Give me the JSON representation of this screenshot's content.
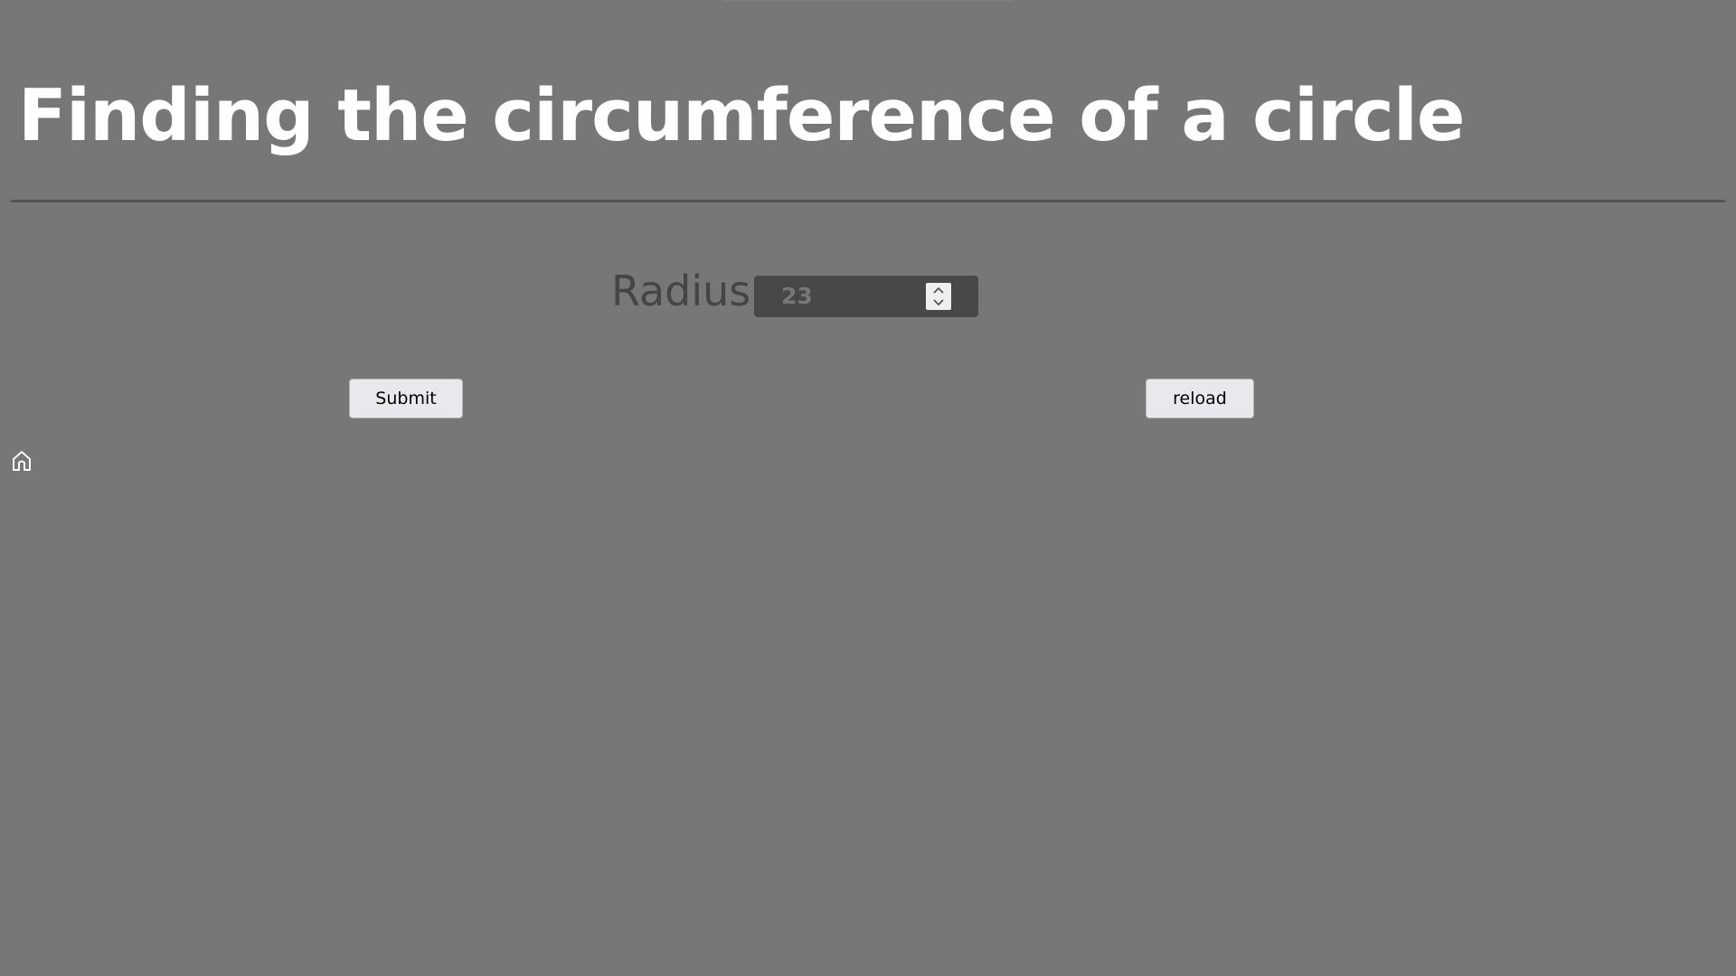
{
  "page": {
    "title": "Finding the circumference of a circle"
  },
  "form": {
    "radius_label": "Radius",
    "radius_value": "23"
  },
  "buttons": {
    "submit_label": "Submit",
    "reload_label": "reload"
  },
  "icons": {
    "home": "home-icon",
    "spinner_up": "chevron-up-icon",
    "spinner_down": "chevron-down-icon"
  },
  "colors": {
    "background": "#777777",
    "title": "#ffffff",
    "label": "#454545",
    "input_background": "#484848",
    "button_background": "#e9e9ed"
  }
}
